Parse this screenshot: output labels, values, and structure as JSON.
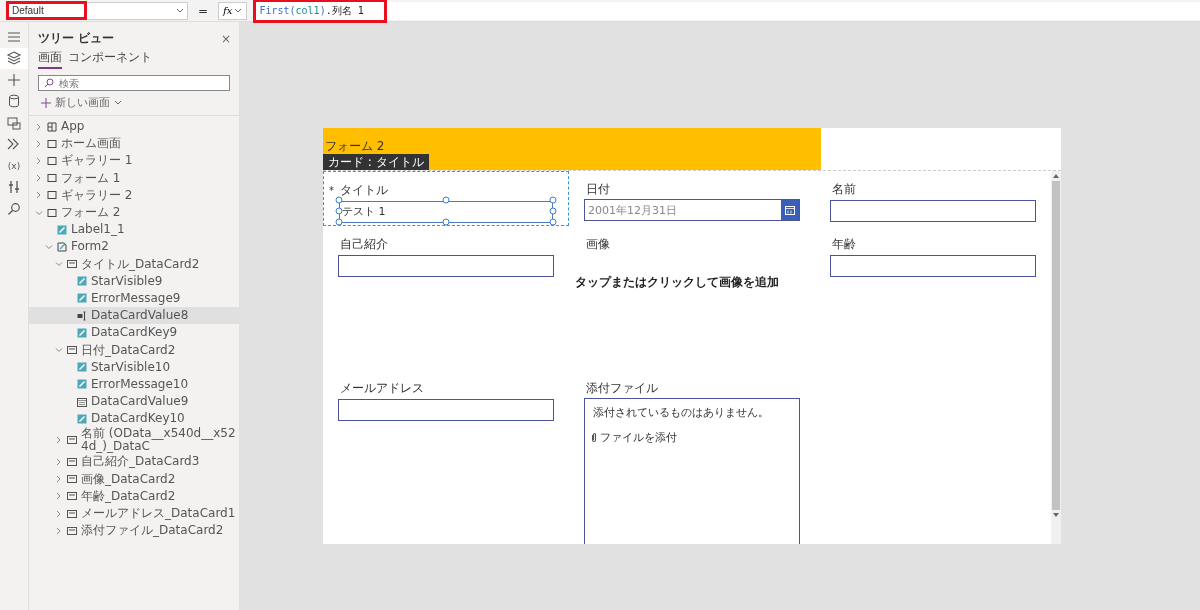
{
  "formula_bar": {
    "property": {
      "value": "Default",
      "highlighted": true
    },
    "equals": "=",
    "fx": "fx",
    "formula": {
      "highlighted": true,
      "tokens": [
        {
          "kind": "function",
          "text": "First("
        },
        {
          "kind": "identifier",
          "text": "col1"
        },
        {
          "kind": "function",
          "text": ")"
        },
        {
          "kind": "plain",
          "text": ".列名 1"
        }
      ]
    }
  },
  "rail": [
    {
      "kind": "menu",
      "selected": false
    },
    {
      "kind": "layers",
      "selected": true
    },
    {
      "kind": "plus",
      "selected": false
    },
    {
      "kind": "database",
      "selected": false
    },
    {
      "kind": "media",
      "selected": false
    },
    {
      "kind": "flow",
      "selected": false
    },
    {
      "kind": "text",
      "glyph": "(x)",
      "selected": false
    },
    {
      "kind": "tools",
      "selected": false
    },
    {
      "kind": "search",
      "selected": false
    }
  ],
  "tree_view": {
    "title": "ツリー ビュー",
    "close": "×",
    "tabs": [
      {
        "label": "画面",
        "selected": true
      },
      {
        "label": "コンポーネント",
        "selected": false
      }
    ],
    "search": {
      "placeholder": "検索"
    },
    "new_screen": "新しい画面",
    "items": [
      {
        "label": "App",
        "kind": "app",
        "expanded": false,
        "selected": false
      },
      {
        "label": "ホーム画面",
        "kind": "screen",
        "expanded": false,
        "selected": false
      },
      {
        "label": "ギャラリー 1",
        "kind": "screen",
        "expanded": false,
        "selected": false
      },
      {
        "label": "フォーム 1",
        "kind": "screen",
        "expanded": false,
        "selected": false
      },
      {
        "label": "ギャラリー 2",
        "kind": "screen",
        "expanded": false,
        "selected": false
      },
      {
        "label": "フォーム 2",
        "kind": "screen",
        "expanded": true,
        "selected": false,
        "children": [
          {
            "label": "Label1_1",
            "kind": "label",
            "selected": false
          },
          {
            "label": "Form2",
            "kind": "form",
            "expanded": true,
            "selected": false,
            "children": [
              {
                "label": "タイトル_DataCard2",
                "kind": "card",
                "expanded": true,
                "selected": false,
                "children": [
                  {
                    "label": "StarVisible9",
                    "kind": "label",
                    "selected": false
                  },
                  {
                    "label": "ErrorMessage9",
                    "kind": "label",
                    "selected": false
                  },
                  {
                    "label": "DataCardValue8",
                    "kind": "input",
                    "selected": true
                  },
                  {
                    "label": "DataCardKey9",
                    "kind": "label",
                    "selected": false
                  }
                ]
              },
              {
                "label": "日付_DataCard2",
                "kind": "card",
                "expanded": true,
                "selected": false,
                "children": [
                  {
                    "label": "StarVisible10",
                    "kind": "label",
                    "selected": false
                  },
                  {
                    "label": "ErrorMessage10",
                    "kind": "label",
                    "selected": false
                  },
                  {
                    "label": "DataCardValue9",
                    "kind": "date",
                    "selected": false
                  },
                  {
                    "label": "DataCardKey10",
                    "kind": "label",
                    "selected": false
                  }
                ]
              },
              {
                "label": "名前 (OData__x540d__x524d_)_DataC",
                "kind": "card",
                "expanded": false,
                "selected": false
              },
              {
                "label": "自己紹介_DataCard3",
                "kind": "card",
                "expanded": false,
                "selected": false
              },
              {
                "label": "画像_DataCard2",
                "kind": "card",
                "expanded": false,
                "selected": false
              },
              {
                "label": "年齢_DataCard2",
                "kind": "card",
                "expanded": false,
                "selected": false
              },
              {
                "label": "メールアドレス_DataCard1",
                "kind": "card",
                "expanded": false,
                "selected": false
              },
              {
                "label": "添付ファイル_DataCard2",
                "kind": "card",
                "expanded": false,
                "selected": false
              }
            ]
          }
        ]
      }
    ]
  },
  "form": {
    "header": "フォーム 2",
    "tooltip": "カード : タイトル",
    "cards": [
      {
        "kind": "text",
        "label": "タイトル",
        "required_mark": "*",
        "value": "テスト 1",
        "selected": true
      },
      {
        "kind": "date",
        "label": "日付",
        "value": "2001年12月31日"
      },
      {
        "kind": "text",
        "label": "名前"
      },
      {
        "kind": "text",
        "label": "自己紹介"
      },
      {
        "kind": "image",
        "label": "画像",
        "prompt": "タップまたはクリックして画像を追加"
      },
      {
        "kind": "text",
        "label": "年齢"
      },
      {
        "kind": "text",
        "label": "メールアドレス"
      },
      {
        "kind": "attachments",
        "label": "添付ファイル",
        "empty_text": "添付されているものはありません。",
        "add_text": "ファイルを添付"
      }
    ]
  }
}
